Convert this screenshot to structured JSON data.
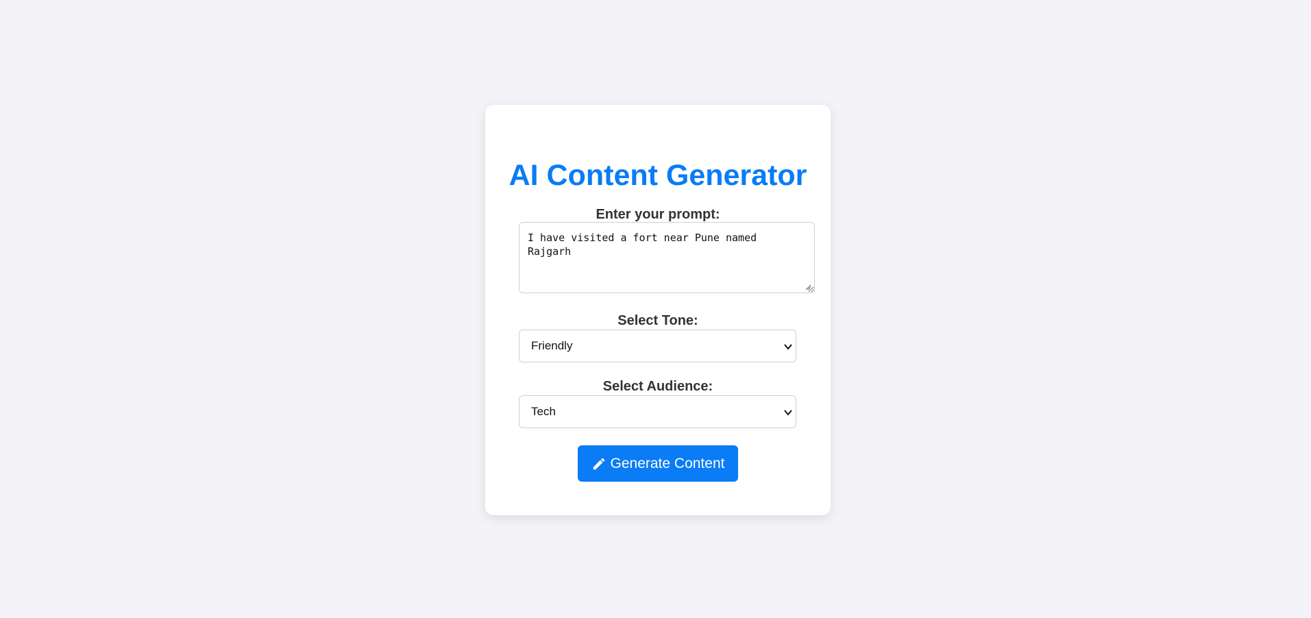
{
  "app": {
    "title": "AI Content Generator"
  },
  "form": {
    "prompt": {
      "label": "Enter your prompt:",
      "value": "I have visited a fort near Pune named Rajgarh"
    },
    "tone": {
      "label": "Select Tone:",
      "selected": "Friendly"
    },
    "audience": {
      "label": "Select Audience:",
      "selected": "Tech"
    },
    "submit": {
      "label": "Generate Content",
      "icon": "pencil-icon"
    }
  },
  "colors": {
    "accent": "#0a7cf5",
    "background": "#f3f3f8",
    "card": "#ffffff",
    "label_text": "#333333"
  }
}
